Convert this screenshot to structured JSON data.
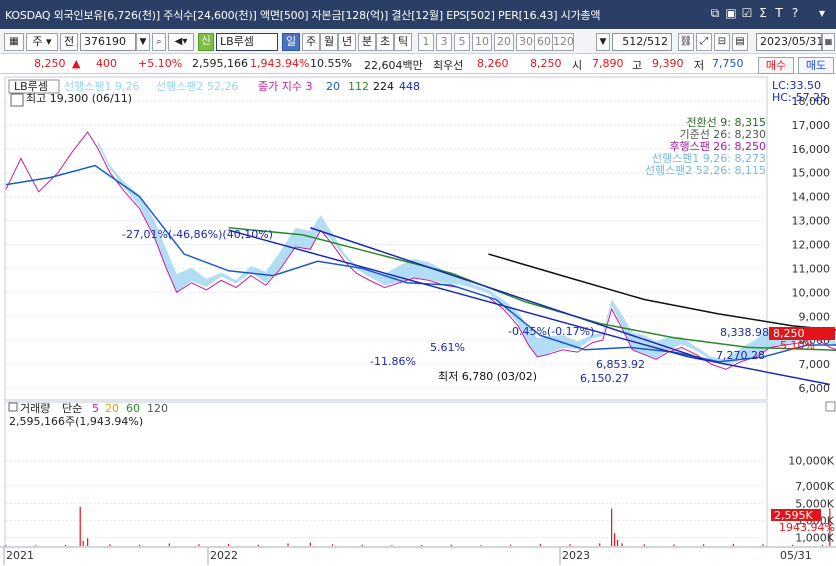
{
  "title_bar": {
    "text": "KOSDAQ 외국인보유[6,726(천)] 주식수[24,600(천)] 액면[500] 자본금[128(억)] 결산[12월] EPS[502] PER[16.43] 시가총액",
    "icons": [
      "window-icon",
      "layout-icon",
      "checkbox-icon",
      "sigma-icon",
      "text-icon",
      "help-icon",
      "menu-icon"
    ],
    "icon_glyphs": [
      "⧉",
      "▣",
      "☑",
      "Σ",
      "T",
      "?",
      "▾"
    ]
  },
  "toolbar": {
    "market_type": "주",
    "prefix": "전",
    "code": "376190",
    "name": "LB루셈",
    "periods": [
      "일",
      "주",
      "월",
      "년",
      "분",
      "초",
      "틱"
    ],
    "active_period": "일",
    "intervals": [
      "1",
      "3",
      "5",
      "10",
      "20",
      "30",
      "60",
      "120"
    ],
    "count_label": "512",
    "count_total": "/512",
    "date": "2023/05/31"
  },
  "quote": {
    "price": "8,250",
    "change_arrow": "▲",
    "change": "400",
    "change_pct": "+5.10%",
    "volume": "2,595,166",
    "volume_ratio": "1,943.94%",
    "turnover_pct": "10.55%",
    "amount": "22,604백만",
    "pref_label": "최우선",
    "best_ask": "8,260",
    "best_bid": "8,250",
    "open_label": "시",
    "open": "7,890",
    "high_label": "고",
    "high": "9,390",
    "low_label": "저",
    "low": "7,750",
    "buy_label": "매수",
    "sell_label": "매도"
  },
  "price_panel": {
    "legend": {
      "stock": "LB루셈",
      "items": [
        {
          "label": "선행스팬1 9,26",
          "color": "#9ad2f0"
        },
        {
          "label": "선행스팬2 52,26",
          "color": "#9ad2f0"
        },
        {
          "label": "종가 지수 3",
          "color": "#c81aa0"
        },
        {
          "label": "20",
          "color": "#1a5ac8"
        },
        {
          "label": "112",
          "color": "#2a8a2a"
        },
        {
          "label": "224",
          "color": "#111111"
        },
        {
          "label": "448",
          "color": "#1a2ab0"
        }
      ]
    },
    "high_note": "최고 19,300 (06/11)",
    "right_info": [
      "LC:33.50",
      "HC:-57.25"
    ],
    "indicator_values": [
      {
        "label": "전환선 9: 8,315",
        "color": "#2a6a2a"
      },
      {
        "label": "기준선 26: 8,230",
        "color": "#555555"
      },
      {
        "label": "후행스팬 26: 8,250",
        "color": "#a020a0"
      },
      {
        "label": "선행스팬1 9,26: 8,273",
        "color": "#7ab8e0"
      },
      {
        "label": "선행스팬2 52,26: 8,115",
        "color": "#7ab8e0"
      }
    ],
    "current_price_tag": "8,250",
    "current_change_tag": "5.10%",
    "annotations": [
      {
        "text": "-27,01%(-46,86%)(40,10%)",
        "color": "#1a2ab0"
      },
      {
        "text": "-0.45%(-0.17%)",
        "color": "#1a2ab0"
      },
      {
        "text": "8,338.98",
        "color": "#1a2ab0"
      },
      {
        "text": "7,270.28",
        "color": "#1a2ab0"
      },
      {
        "text": "6,853.92",
        "color": "#1a2ab0"
      },
      {
        "text": "6,150.27",
        "color": "#1a2ab0"
      },
      {
        "text": "최저 6,780 (03/02)",
        "color": "#111111"
      },
      {
        "text": "-11.86%",
        "color": "#1a2ab0"
      },
      {
        "text": "5.61%",
        "color": "#1a2ab0"
      }
    ]
  },
  "volume_panel": {
    "legend": {
      "name": "거래량",
      "type": "단순",
      "periods": [
        {
          "label": "5",
          "color": "#c81aa0"
        },
        {
          "label": "20",
          "color": "#d4a200"
        },
        {
          "label": "60",
          "color": "#2a8a2a"
        },
        {
          "label": "120",
          "color": "#555555"
        }
      ]
    },
    "value_text": "2,595,166주(1,943.94%)",
    "current_tag": "2,595K",
    "current_pct_tag": "1943.94%"
  },
  "time_axis": {
    "labels": [
      "2021",
      "2022",
      "2023"
    ],
    "end_label": "05/31"
  },
  "chart_data": {
    "type": "line",
    "title": "LB루셈",
    "ylim": [
      5500,
      19000
    ],
    "y_ticks": [
      6000,
      7000,
      8000,
      9000,
      10000,
      11000,
      12000,
      13000,
      14000,
      15000,
      16000,
      17000,
      18000
    ],
    "y_tick_labels": [
      "6,000",
      "7,000",
      "8,000",
      "9,000",
      "10,000",
      "11,000",
      "12,000",
      "13,000",
      "14,000",
      "15,000",
      "16,000",
      "17,000",
      "18,000"
    ],
    "x_range": [
      0,
      512
    ],
    "series": [
      {
        "name": "LB루셈",
        "color": "#c81aa0",
        "values": [
          [
            0,
            14300
          ],
          [
            10,
            15600
          ],
          [
            22,
            14200
          ],
          [
            35,
            15000
          ],
          [
            45,
            15900
          ],
          [
            55,
            16700
          ],
          [
            62,
            16000
          ],
          [
            70,
            15000
          ],
          [
            80,
            14200
          ],
          [
            90,
            13500
          ],
          [
            100,
            12300
          ],
          [
            108,
            11000
          ],
          [
            115,
            10000
          ],
          [
            125,
            10400
          ],
          [
            135,
            10100
          ],
          [
            145,
            10500
          ],
          [
            155,
            10200
          ],
          [
            165,
            10700
          ],
          [
            175,
            10300
          ],
          [
            185,
            11000
          ],
          [
            195,
            11900
          ],
          [
            205,
            11800
          ],
          [
            212,
            12600
          ],
          [
            220,
            12000
          ],
          [
            228,
            11300
          ],
          [
            236,
            10800
          ],
          [
            245,
            10500
          ],
          [
            255,
            10200
          ],
          [
            265,
            10400
          ],
          [
            275,
            10600
          ],
          [
            285,
            10500
          ],
          [
            295,
            10300
          ],
          [
            305,
            10200
          ],
          [
            315,
            10000
          ],
          [
            325,
            9800
          ],
          [
            335,
            9300
          ],
          [
            345,
            8600
          ],
          [
            352,
            7800
          ],
          [
            358,
            7300
          ],
          [
            365,
            7400
          ],
          [
            375,
            7600
          ],
          [
            385,
            7500
          ],
          [
            395,
            7900
          ],
          [
            402,
            8000
          ],
          [
            408,
            9300
          ],
          [
            415,
            8500
          ],
          [
            422,
            7600
          ],
          [
            430,
            7400
          ],
          [
            438,
            7200
          ],
          [
            446,
            7500
          ],
          [
            455,
            7700
          ],
          [
            465,
            7400
          ],
          [
            475,
            7000
          ],
          [
            485,
            6780
          ],
          [
            495,
            7100
          ],
          [
            505,
            7300
          ],
          [
            515,
            7700
          ],
          [
            525,
            7800
          ],
          [
            535,
            7900
          ],
          [
            545,
            8100
          ],
          [
            555,
            7700
          ],
          [
            565,
            7500
          ],
          [
            575,
            7900
          ],
          [
            585,
            7600
          ],
          [
            595,
            7500
          ],
          [
            605,
            7700
          ],
          [
            615,
            7800
          ],
          [
            625,
            7800
          ],
          [
            635,
            8000
          ],
          [
            645,
            8050
          ],
          [
            655,
            7700
          ],
          [
            665,
            7600
          ],
          [
            675,
            7700
          ],
          [
            685,
            7600
          ],
          [
            695,
            7850
          ],
          [
            702,
            8250
          ]
        ]
      },
      {
        "name": "20",
        "color": "#1a5ac8",
        "values": [
          [
            0,
            14500
          ],
          [
            30,
            14800
          ],
          [
            60,
            15300
          ],
          [
            90,
            14000
          ],
          [
            120,
            11600
          ],
          [
            150,
            10900
          ],
          [
            180,
            10700
          ],
          [
            210,
            11300
          ],
          [
            240,
            11000
          ],
          [
            270,
            10400
          ],
          [
            300,
            10300
          ],
          [
            330,
            9700
          ],
          [
            360,
            8200
          ],
          [
            390,
            7600
          ],
          [
            420,
            7700
          ],
          [
            450,
            7500
          ],
          [
            480,
            7100
          ],
          [
            510,
            7300
          ],
          [
            540,
            7800
          ],
          [
            570,
            7800
          ],
          [
            600,
            7600
          ],
          [
            630,
            7800
          ],
          [
            660,
            7800
          ],
          [
            690,
            7700
          ],
          [
            702,
            7900
          ]
        ]
      },
      {
        "name": "112",
        "color": "#2a8a2a",
        "values": [
          [
            150,
            12700
          ],
          [
            200,
            12400
          ],
          [
            250,
            11600
          ],
          [
            300,
            10800
          ],
          [
            350,
            9600
          ],
          [
            400,
            8700
          ],
          [
            450,
            8100
          ],
          [
            500,
            7700
          ],
          [
            550,
            7600
          ],
          [
            600,
            7500
          ],
          [
            650,
            7500
          ],
          [
            702,
            7700
          ]
        ]
      },
      {
        "name": "224",
        "color": "#111111",
        "values": [
          [
            325,
            11600
          ],
          [
            380,
            10600
          ],
          [
            430,
            9700
          ],
          [
            480,
            9100
          ],
          [
            530,
            8600
          ],
          [
            580,
            8300
          ],
          [
            630,
            8200
          ],
          [
            680,
            8100
          ],
          [
            702,
            8100
          ]
        ]
      }
    ],
    "trendlines": [
      [
        [
          150,
          12600
        ],
        [
          460,
          7300
        ]
      ],
      [
        [
          205,
          12700
        ],
        [
          470,
          7200
        ]
      ],
      [
        [
          460,
          7300
        ],
        [
          555,
          6150
        ]
      ],
      [
        [
          580,
          8340
        ],
        [
          702,
          8340
        ]
      ],
      [
        [
          580,
          6850
        ],
        [
          702,
          7270
        ]
      ],
      [
        [
          645,
          9400
        ],
        [
          695,
          9300
        ]
      ]
    ],
    "volume": {
      "ylim": [
        0,
        13000
      ],
      "y_ticks": [
        1000,
        3000,
        5000,
        7000,
        10000
      ],
      "y_tick_labels": [
        "1,000K",
        "3,000K",
        "5,000K",
        "7,000K",
        "10,000K"
      ],
      "bars": [
        [
          0,
          100
        ],
        [
          20,
          80
        ],
        [
          40,
          120
        ],
        [
          50,
          4600
        ],
        [
          52,
          600
        ],
        [
          55,
          900
        ],
        [
          70,
          200
        ],
        [
          90,
          150
        ],
        [
          110,
          300
        ],
        [
          130,
          200
        ],
        [
          150,
          250
        ],
        [
          170,
          150
        ],
        [
          190,
          300
        ],
        [
          205,
          400
        ],
        [
          220,
          200
        ],
        [
          240,
          150
        ],
        [
          260,
          100
        ],
        [
          280,
          120
        ],
        [
          300,
          150
        ],
        [
          320,
          100
        ],
        [
          340,
          150
        ],
        [
          360,
          250
        ],
        [
          380,
          200
        ],
        [
          400,
          300
        ],
        [
          408,
          4400
        ],
        [
          410,
          1500
        ],
        [
          412,
          700
        ],
        [
          415,
          300
        ],
        [
          430,
          200
        ],
        [
          450,
          180
        ],
        [
          470,
          200
        ],
        [
          490,
          250
        ],
        [
          510,
          200
        ],
        [
          530,
          150
        ],
        [
          550,
          150
        ],
        [
          555,
          4400
        ],
        [
          560,
          1200
        ],
        [
          565,
          500
        ],
        [
          580,
          150
        ],
        [
          600,
          200
        ],
        [
          620,
          150
        ],
        [
          640,
          180
        ],
        [
          660,
          150
        ],
        [
          680,
          200
        ],
        [
          690,
          100
        ],
        [
          702,
          2595
        ]
      ]
    }
  }
}
